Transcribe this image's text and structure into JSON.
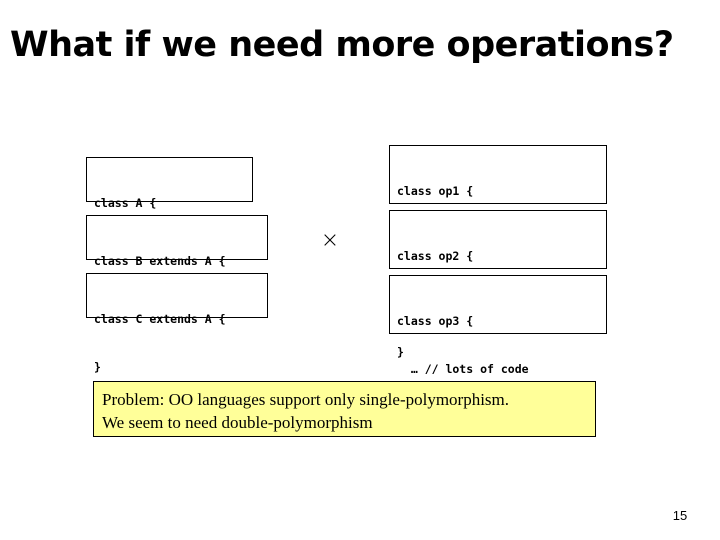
{
  "slide": {
    "title": "What if we need more operations?",
    "page_number": "15",
    "operator_symbol": "×",
    "colors": {
      "background": "#ffffff",
      "text": "#000000",
      "callout_fill": "#ffff99",
      "box_border": "#000000"
    }
  },
  "class_boxes": [
    {
      "id": "class-a",
      "lines": [
        "class A {",
        "}"
      ]
    },
    {
      "id": "class-b",
      "lines": [
        "class B extends A {",
        "}"
      ]
    },
    {
      "id": "class-c",
      "lines": [
        "class C extends A {",
        "}"
      ]
    }
  ],
  "operation_boxes": [
    {
      "id": "op1",
      "lines": [
        "class op1 {",
        "  … // lots of code",
        "}"
      ]
    },
    {
      "id": "op2",
      "lines": [
        "class op2 {",
        "  … // lots of code",
        "}"
      ]
    },
    {
      "id": "op3",
      "lines": [
        "class op3 {",
        "  … // lots of code",
        "}"
      ]
    }
  ],
  "problem_callout": {
    "line1": "Problem: OO languages support only single-polymorphism.",
    "line2": "We seem to need double-polymorphism"
  }
}
